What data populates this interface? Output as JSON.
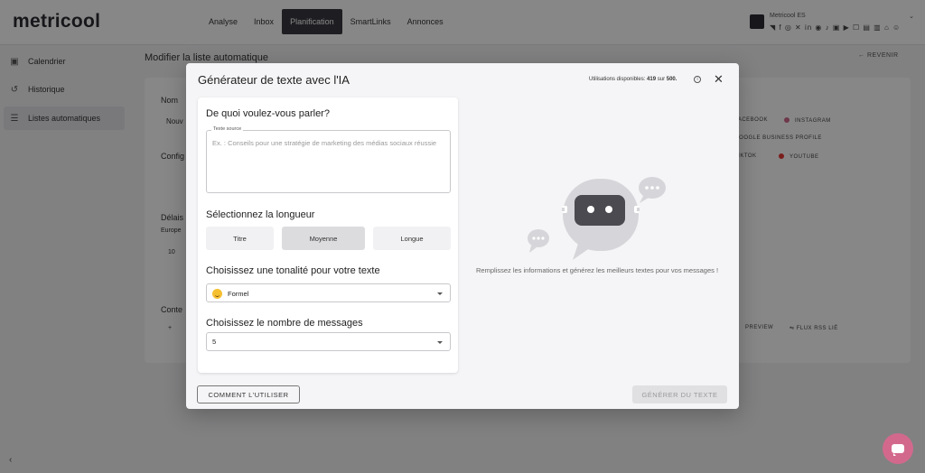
{
  "app": {
    "logo": "metricool"
  },
  "topnav": {
    "items": [
      {
        "label": "Analyse",
        "active": false
      },
      {
        "label": "Inbox",
        "active": false
      },
      {
        "label": "Planification",
        "active": true
      },
      {
        "label": "SmartLinks",
        "active": false
      },
      {
        "label": "Annonces",
        "active": false
      }
    ]
  },
  "account": {
    "name": "Metricool ES",
    "network_icons": "◥ f ◎ ✕ in ◉ ♪ ▣ ▶ ☐ ▤ ▥ ⌂ ☺"
  },
  "sidebar": {
    "items": [
      {
        "label": "Calendrier",
        "icon": "calendar-icon",
        "glyph": "▣",
        "active": false
      },
      {
        "label": "Historique",
        "icon": "history-icon",
        "glyph": "↺",
        "active": false
      },
      {
        "label": "Listes automatiques",
        "icon": "list-icon",
        "glyph": "☰",
        "active": true
      }
    ],
    "collapse_glyph": "‹"
  },
  "page": {
    "title": "Modifier la liste automatique",
    "back_label": "← REVENIR",
    "card_labels": [
      "Nom",
      "Nouv",
      "Config",
      "Délais",
      "Europe",
      "10",
      "Conte",
      "+"
    ],
    "networks": [
      "FACEBOOK",
      "INSTAGRAM",
      "GOOGLE BUSINESS PROFILE",
      "TIKTOK",
      "YOUTUBE"
    ],
    "bottom_links": [
      "PREVIEW",
      "FLUX RSS LIÉ"
    ]
  },
  "modal": {
    "title": "Générateur de texte avec l'IA",
    "usage_prefix": "Utilisations disponibles:",
    "usage_used": "419",
    "usage_mid": "sur",
    "usage_total": "500.",
    "topic_question": "De quoi voulez-vous parler?",
    "source_legend": "Texte source",
    "source_placeholder": "Ex. : Conseils pour une stratégie de marketing des médias sociaux réussie",
    "length_question": "Sélectionnez la longueur",
    "length_options": [
      {
        "label": "Titre",
        "selected": false
      },
      {
        "label": "Moyenne",
        "selected": true
      },
      {
        "label": "Longue",
        "selected": false
      }
    ],
    "tone_question": "Choisissez une tonalité pour votre texte",
    "tone_value": "Formel",
    "count_question": "Choisissez le nombre de messages",
    "count_value": "5",
    "hint": "Remplissez les informations et générez les meilleurs textes pour vos messages !",
    "how_to_label": "COMMENT L'UTILISER",
    "generate_label": "GÉNÉRER DU TEXTE"
  },
  "colors": {
    "accent": "#d2698d",
    "dark": "#3a3a40",
    "robot": "#d6d6da"
  }
}
